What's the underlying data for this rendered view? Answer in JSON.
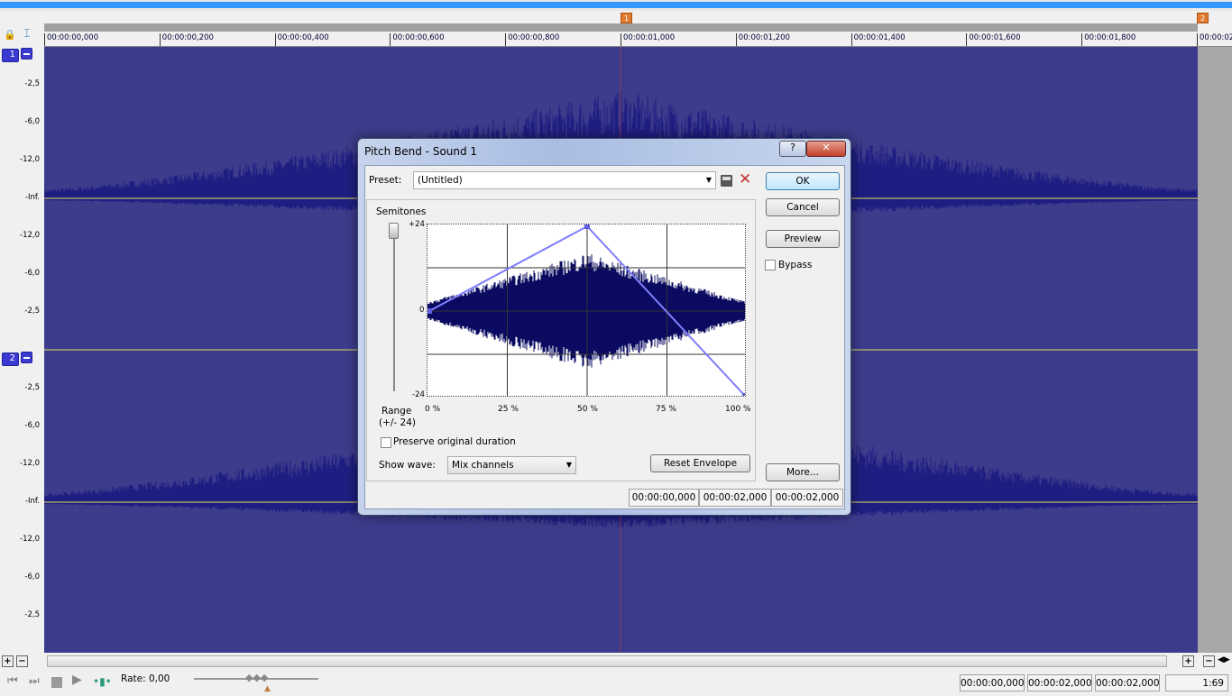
{
  "timeline": {
    "markers": [
      "1",
      "2"
    ],
    "ticks": [
      "00:00:00,000",
      "00:00:00,200",
      "00:00:00,400",
      "00:00:00,600",
      "00:00:00,800",
      "00:00:01,000",
      "00:00:01,200",
      "00:00:01,400",
      "00:00:01,600",
      "00:00:01,800",
      "00:00:02"
    ]
  },
  "tracks": [
    {
      "number": "1",
      "levels": [
        "-2,5",
        "-6,0",
        "-12,0",
        "-Inf.",
        "-12,0",
        "-6,0",
        "-2,5"
      ]
    },
    {
      "number": "2",
      "levels": [
        "-2,5",
        "-6,0",
        "-12,0",
        "-Inf.",
        "-12,0",
        "-6,0",
        "-2,5"
      ]
    }
  ],
  "colors": {
    "waveform": "#3c3c8c",
    "wave_fill": "#1e1e82",
    "envelope": "#8080ff",
    "center_line": "#e8e060"
  },
  "dialog": {
    "title": "Pitch Bend - Sound 1",
    "preset_label": "Preset:",
    "preset_value": "(Untitled)",
    "semitones_label": "Semitones",
    "y_top": "+24",
    "y_mid": "0",
    "y_bottom": "-24",
    "x_ticks": [
      "0 %",
      "25 %",
      "50 %",
      "75 %",
      "100 %"
    ],
    "range_label": "Range",
    "range_value": "(+/- 24)",
    "envelope_points": [
      {
        "pos_pct": 0,
        "semitones": 0
      },
      {
        "pos_pct": 50,
        "semitones": 24
      },
      {
        "pos_pct": 100,
        "semitones": -24
      }
    ],
    "preserve_label": "Preserve original duration",
    "preserve_checked": false,
    "show_wave_label": "Show wave:",
    "show_wave_value": "Mix channels",
    "reset_label": "Reset Envelope",
    "ok": "OK",
    "cancel": "Cancel",
    "preview": "Preview",
    "bypass": "Bypass",
    "bypass_checked": false,
    "more": "More...",
    "status": [
      "00:00:00,000",
      "00:00:02,000",
      "00:00:02,000"
    ]
  },
  "transport": {
    "rate": "Rate: 0,00"
  },
  "status": {
    "start": "00:00:00,000",
    "end": "00:00:02,000",
    "length": "00:00:02,000",
    "zoom": "1:69"
  }
}
